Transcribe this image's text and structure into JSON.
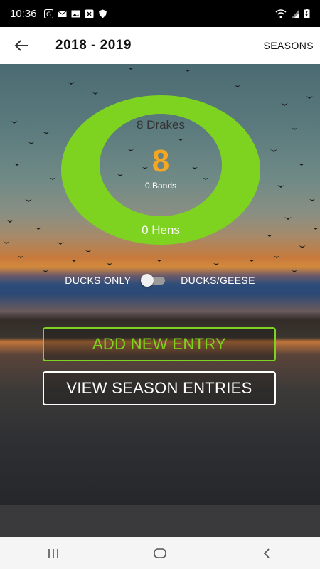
{
  "status_bar": {
    "time": "10:36",
    "icons": [
      "google-icon",
      "gmail-icon",
      "gallery-icon",
      "x-box-icon",
      "shield-icon"
    ],
    "right_icons": [
      "wifi-icon",
      "signal-icon",
      "battery-icon"
    ]
  },
  "app_bar": {
    "back_icon": "arrow-left-icon",
    "title": "2018 - 2019",
    "seasons_label": "SEASONS"
  },
  "summary": {
    "drakes_label": "8 Drakes",
    "hens_label": "0 Hens",
    "total": "8",
    "bands_label": "0 Bands",
    "ring_color": "#7ed321",
    "total_color": "#f5a623"
  },
  "toggle": {
    "left_label": "DUCKS ONLY",
    "right_label": "DUCKS/GEESE",
    "state": "ducks-only"
  },
  "buttons": {
    "add_entry": "ADD NEW ENTRY",
    "view_entries": "VIEW SEASON ENTRIES",
    "add_color": "#7ed321"
  },
  "nav": {
    "recents_icon": "recents-icon",
    "home_icon": "home-icon",
    "back_icon": "back-icon"
  }
}
